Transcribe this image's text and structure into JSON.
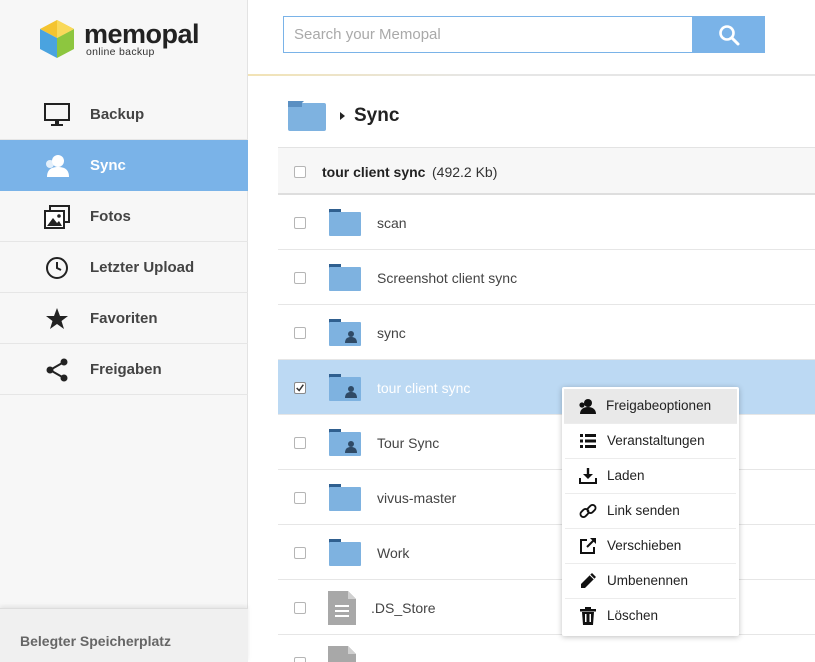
{
  "app": {
    "brand": "memopal",
    "tagline": "online backup"
  },
  "sidebar": {
    "items": [
      {
        "label": "Backup",
        "icon": "monitor-icon",
        "active": false
      },
      {
        "label": "Sync",
        "icon": "user-icon",
        "active": true
      },
      {
        "label": "Fotos",
        "icon": "photos-icon",
        "active": false
      },
      {
        "label": "Letzter Upload",
        "icon": "clock-icon",
        "active": false
      },
      {
        "label": "Favoriten",
        "icon": "star-icon",
        "active": false
      },
      {
        "label": "Freigaben",
        "icon": "share-icon",
        "active": false
      }
    ],
    "storage_label": "Belegter Speicherplatz"
  },
  "search": {
    "placeholder": "Search your Memopal",
    "value": ""
  },
  "breadcrumb": {
    "current": "Sync"
  },
  "list": {
    "header_name": "tour client sync",
    "header_size": "(492.2 Kb)",
    "rows": [
      {
        "name": "scan",
        "type": "folder",
        "shared": false,
        "checked": false
      },
      {
        "name": "Screenshot client sync",
        "type": "folder",
        "shared": false,
        "checked": false
      },
      {
        "name": "sync",
        "type": "folder",
        "shared": true,
        "checked": false
      },
      {
        "name": "tour client sync",
        "type": "folder",
        "shared": true,
        "checked": true
      },
      {
        "name": "Tour Sync",
        "type": "folder",
        "shared": true,
        "checked": false
      },
      {
        "name": "vivus-master",
        "type": "folder",
        "shared": false,
        "checked": false
      },
      {
        "name": "Work",
        "type": "folder",
        "shared": false,
        "checked": false
      },
      {
        "name": ".DS_Store",
        "type": "file",
        "shared": false,
        "checked": false
      }
    ]
  },
  "context_menu": {
    "items": [
      {
        "label": "Freigabeoptionen",
        "icon": "user-share-icon"
      },
      {
        "label": "Veranstaltungen",
        "icon": "list-icon"
      },
      {
        "label": "Laden",
        "icon": "download-icon"
      },
      {
        "label": "Link senden",
        "icon": "link-icon"
      },
      {
        "label": "Verschieben",
        "icon": "move-icon"
      },
      {
        "label": "Umbenennen",
        "icon": "pencil-icon"
      },
      {
        "label": "Löschen",
        "icon": "trash-icon"
      }
    ]
  },
  "colors": {
    "accent": "#7ab3e8",
    "selected_row": "#bcd9f3",
    "folder": "#7eb2e0"
  }
}
